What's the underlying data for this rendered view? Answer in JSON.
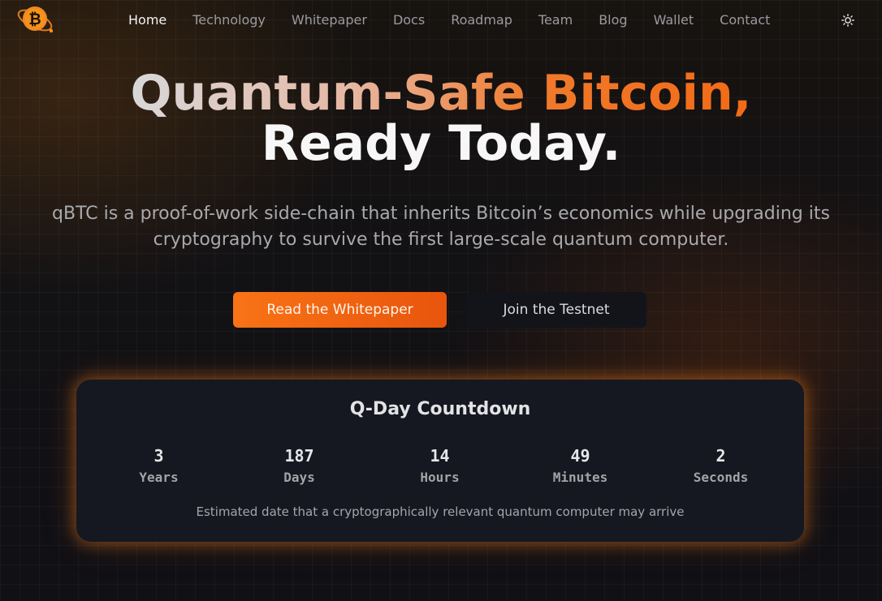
{
  "nav": {
    "links": [
      "Home",
      "Technology",
      "Whitepaper",
      "Docs",
      "Roadmap",
      "Team",
      "Blog",
      "Wallet",
      "Contact"
    ],
    "active": "Home",
    "logo_icon": "bitcoin-logo-icon",
    "theme_icon": "sun-icon"
  },
  "hero": {
    "title_line1": "Quantum-Safe Bitcoin,",
    "title_line2": "Ready Today.",
    "subtitle": "qBTC is a proof-of-work side-chain that inherits Bitcoin’s economics while upgrading its cryptography to survive the first large-scale quantum computer.",
    "primary_cta": "Read the Whitepaper",
    "secondary_cta": "Join the Testnet"
  },
  "countdown": {
    "title": "Q-Day Countdown",
    "units": [
      {
        "value": "3",
        "label": "Years"
      },
      {
        "value": "187",
        "label": "Days"
      },
      {
        "value": "14",
        "label": "Hours"
      },
      {
        "value": "49",
        "label": "Minutes"
      },
      {
        "value": "2",
        "label": "Seconds"
      }
    ],
    "note": "Estimated date that a cryptographically relevant quantum computer may arrive"
  },
  "colors": {
    "accent": "#f97316",
    "background": "#0f1014",
    "card": "#151820"
  }
}
